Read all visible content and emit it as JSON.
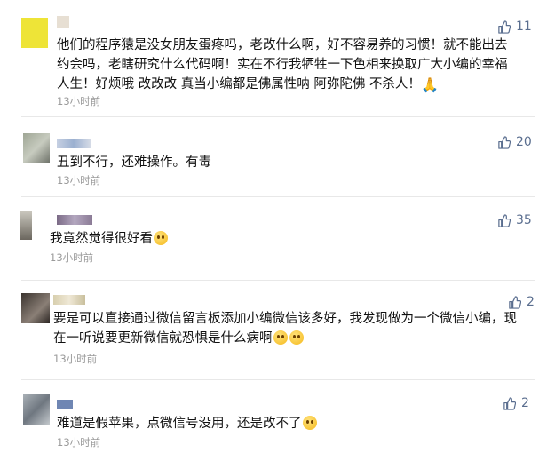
{
  "comments": [
    {
      "text": "他们的程序猿是没女朋友蛋疼吗，老改什么啊，好不容易养的习惯！就不能出去约会吗，老瞎研究什么代码啊！实在不行我牺牲一下色相来换取广大小编的幸福人生！好烦哦 改改改 真当小编都是佛属性呐 阿弥陀佛 不杀人！",
      "emoji": "🙏",
      "time": "13小时前",
      "likes": "11",
      "avatar_color": "#e8e23a",
      "name_color": "#d8cfc4"
    },
    {
      "text": "丑到不行，还难操作。有毒",
      "time": "13小时前",
      "likes": "20",
      "avatar_color": "#9aa08f",
      "name_color": "#b7c4d9"
    },
    {
      "text": "我竟然觉得很好看",
      "time": "13小时前",
      "likes": "35",
      "avatar_color": "#7e7a70",
      "name_color": "#7f6f8a"
    },
    {
      "text": "要是可以直接通过微信留言板添加小编微信该多好，我发现做为一个微信小编，现在一听说要更新微信就恐惧是什么病啊",
      "time": "13小时前",
      "likes": "2",
      "avatar_color": "#5a4f48",
      "name_color": "#d9d0b5"
    },
    {
      "text": "难道是假苹果，点微信号没用，还是改不了",
      "time": "13小时前",
      "likes": "2",
      "avatar_color": "#8a9299",
      "name_color": "#7c90b8"
    }
  ]
}
